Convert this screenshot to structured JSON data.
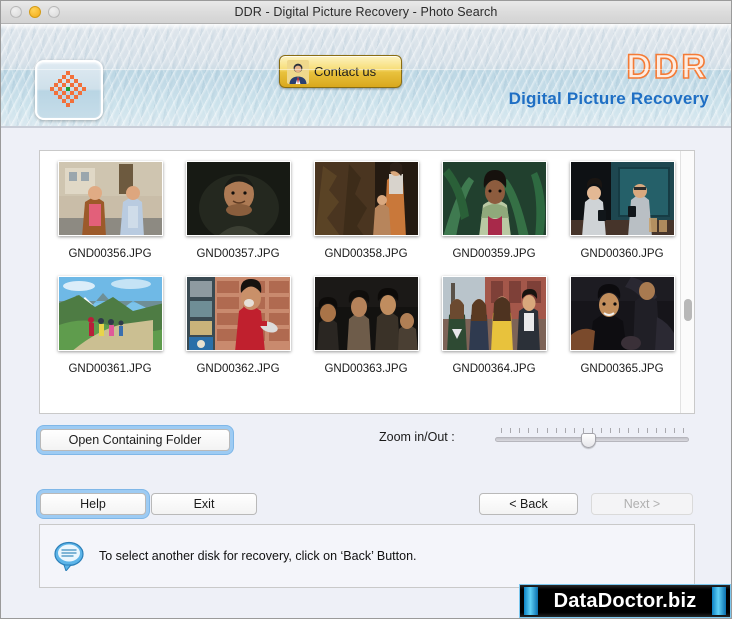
{
  "window": {
    "title": "DDR - Digital Picture Recovery - Photo Search",
    "close_label": "",
    "minimize_label": "",
    "maximize_label": ""
  },
  "header": {
    "app_icon_name": "ddr-flower-logo-icon",
    "contact_button": "Contact us",
    "brand_title": "DDR",
    "brand_subtitle": "Digital Picture Recovery",
    "brand_title_color": "#f47b36",
    "brand_subtitle_color": "#1f6fc4"
  },
  "grid": {
    "rows": [
      [
        {
          "filename": "GND00356.JPG",
          "scene": "two-men-street"
        },
        {
          "filename": "GND00357.JPG",
          "scene": "man-portrait-dark"
        },
        {
          "filename": "GND00358.JPG",
          "scene": "woman-rock-wall"
        },
        {
          "filename": "GND00359.JPG",
          "scene": "woman-green-plants"
        },
        {
          "filename": "GND00360.JPG",
          "scene": "couple-cafe-phones"
        }
      ],
      [
        {
          "filename": "GND00361.JPG",
          "scene": "hikers-mountain-trail"
        },
        {
          "filename": "GND00362.JPG",
          "scene": "woman-red-shirt-market"
        },
        {
          "filename": "GND00363.JPG",
          "scene": "friends-group-dark"
        },
        {
          "filename": "GND00364.JPG",
          "scene": "four-friends-street"
        },
        {
          "filename": "GND00365.JPG",
          "scene": "man-black-shirt-group"
        }
      ]
    ],
    "scrollbar_name": "vertical-scrollbar"
  },
  "controls": {
    "open_containing_folder": "Open Containing Folder",
    "zoom_label": "Zoom in/Out :",
    "zoom_tick_count": 21,
    "zoom_thumb_percent": 48
  },
  "footer": {
    "help": "Help",
    "exit": "Exit",
    "back": "< Back",
    "next": "Next >",
    "next_disabled": true
  },
  "status": {
    "icon_name": "speech-bubble-icon",
    "message": "To select another disk for recovery, click on ‘Back’ Button."
  },
  "watermark": {
    "text": "DataDoctor.biz"
  }
}
